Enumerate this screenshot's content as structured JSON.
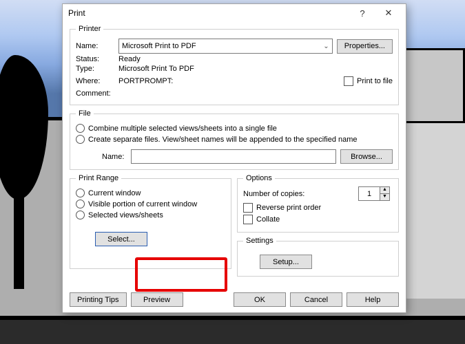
{
  "window": {
    "title": "Print"
  },
  "printer": {
    "legend": "Printer",
    "name_label": "Name:",
    "name_value": "Microsoft Print to PDF",
    "properties_btn": "Properties...",
    "status_label": "Status:",
    "status_value": "Ready",
    "type_label": "Type:",
    "type_value": "Microsoft Print To PDF",
    "where_label": "Where:",
    "where_value": "PORTPROMPT:",
    "comment_label": "Comment:",
    "print_to_file": "Print to file"
  },
  "file": {
    "legend": "File",
    "opt_combine": "Combine multiple selected views/sheets into a single file",
    "opt_separate": "Create separate files. View/sheet names will be appended to the specified name",
    "name_label": "Name:",
    "browse_btn": "Browse..."
  },
  "range": {
    "legend": "Print Range",
    "opt_current": "Current window",
    "opt_visible": "Visible portion of current window",
    "opt_selected": "Selected views/sheets",
    "select_btn": "Select..."
  },
  "options": {
    "legend": "Options",
    "copies_label": "Number of copies:",
    "copies_value": "1",
    "reverse": "Reverse print order",
    "collate": "Collate"
  },
  "settings": {
    "legend": "Settings",
    "setup_btn": "Setup..."
  },
  "buttons": {
    "tips": "Printing Tips",
    "preview": "Preview",
    "ok": "OK",
    "cancel": "Cancel",
    "help": "Help"
  }
}
